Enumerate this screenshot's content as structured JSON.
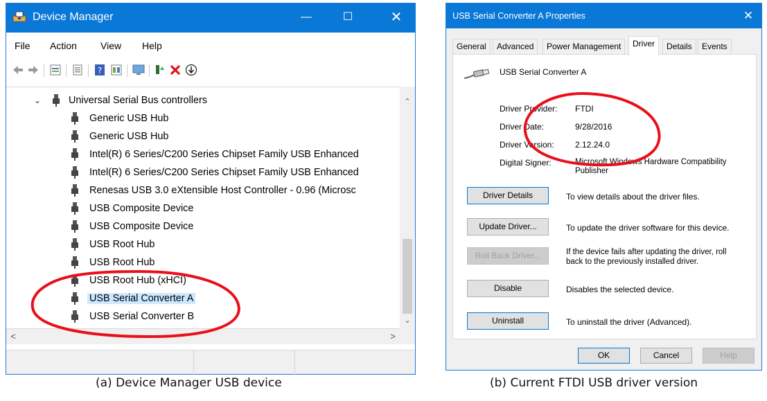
{
  "device_manager": {
    "title": "Device Manager",
    "window_controls": {
      "minimize": "—",
      "maximize": "☐",
      "close": "✕"
    },
    "menu": [
      "File",
      "Action",
      "View",
      "Help"
    ],
    "toolbar_icons": [
      "back-icon",
      "forward-icon",
      "properties-icon",
      "show-hidden-icon",
      "help-icon",
      "update-driver-icon",
      "scan-icon",
      "enable-device-icon",
      "uninstall-icon",
      "download-icon"
    ],
    "tree": {
      "category": "Universal Serial Bus controllers",
      "items": [
        "Generic USB Hub",
        "Generic USB Hub",
        "Intel(R) 6 Series/C200 Series Chipset Family USB Enhanced",
        "Intel(R) 6 Series/C200 Series Chipset Family USB Enhanced",
        "Renesas USB 3.0 eXtensible Host Controller - 0.96 (Microsc",
        "USB Composite Device",
        "USB Composite Device",
        "USB Root Hub",
        "USB Root Hub",
        "USB Root Hub (xHCI)",
        "USB Serial Converter A",
        "USB Serial Converter B"
      ],
      "selected": "USB Serial Converter A"
    },
    "scroll_arrows": {
      "up": "⌃",
      "down": "⌄",
      "left": "<",
      "right": ">"
    }
  },
  "properties_dialog": {
    "title": "USB Serial Converter A Properties",
    "close": "✕",
    "tabs": [
      "General",
      "Advanced",
      "Power Management",
      "Driver",
      "Details",
      "Events"
    ],
    "active_tab": "Driver",
    "device_name": "USB Serial Converter A",
    "fields": {
      "provider_label": "Driver Provider:",
      "provider_value": "FTDI",
      "date_label": "Driver Date:",
      "date_value": "9/28/2016",
      "version_label": "Driver Version:",
      "version_value": "2.12.24.0",
      "signer_label": "Digital Signer:",
      "signer_value_1": "Microsoft Windows Hardware Compatibility",
      "signer_value_2": "Publisher"
    },
    "buttons": {
      "driver_details": "Driver Details",
      "driver_details_desc": "To view details about the driver files.",
      "update_driver": "Update Driver...",
      "update_driver_desc": "To update the driver software for this device.",
      "roll_back": "Roll Back Driver...",
      "roll_back_desc_1": "If the device fails after updating the driver, roll",
      "roll_back_desc_2": "back to the previously installed driver.",
      "disable": "Disable",
      "disable_desc": "Disables the selected device.",
      "uninstall": "Uninstall",
      "uninstall_desc": "To uninstall the driver (Advanced)."
    },
    "footer": {
      "ok": "OK",
      "cancel": "Cancel",
      "help": "Help"
    }
  },
  "captions": {
    "a": "(a)  Device Manager USB device",
    "b": "(b)  Current FTDI USB driver version"
  },
  "colors": {
    "titlebar": "#0a78d7",
    "selection": "#cce8ff",
    "highlight_ellipse": "#e8101a"
  }
}
